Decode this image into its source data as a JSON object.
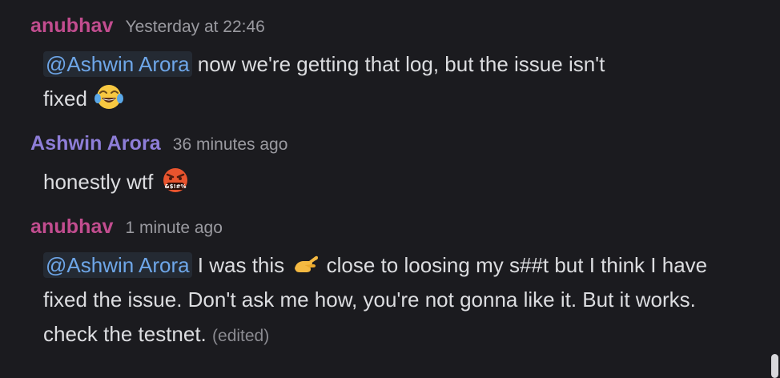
{
  "messages": [
    {
      "author": "anubhav",
      "timestamp": "Yesterday at 22:46",
      "mention": "@Ashwin Arora",
      "text_line1": " now we're getting that log, but the issue isn't",
      "text_line2": "fixed ",
      "emoji": "face-with-tears-of-joy"
    },
    {
      "author": "Ashwin Arora",
      "timestamp": "36 minutes ago",
      "text": "honestly wtf ",
      "emoji": "face-with-symbols-on-mouth"
    },
    {
      "author": "anubhav",
      "timestamp": "1 minute ago",
      "mention": "@Ashwin Arora",
      "text_part1": " I was this ",
      "emoji": "pinching-hand",
      "text_part2": " close to loosing my s##t but I think I have fixed the issue. Don't ask me how, you're not gonna like it. But it works. check the testnet. ",
      "edited": "(edited)"
    }
  ],
  "colors": {
    "background": "#1b1b1f",
    "anubhav": "#c24d8f",
    "ashwin": "#8e7ed8",
    "mention": "#6ea6e8",
    "timestamp": "#9a9aa0"
  }
}
